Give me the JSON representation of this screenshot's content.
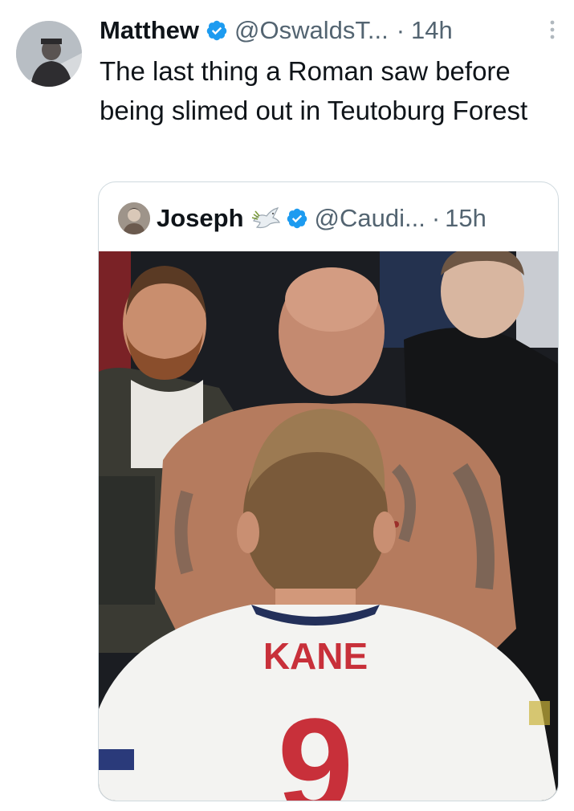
{
  "tweet": {
    "author_name": "Matthew",
    "handle": "@OswaldsT...",
    "separator": "·",
    "time": "14h",
    "text": "The last thing a Roman saw before being slimed out in Teutoburg Forest"
  },
  "quoted_tweet": {
    "author_name": "Joseph",
    "handle": "@Caudi...",
    "separator": "·",
    "time": "15h",
    "jersey_name": "KANE",
    "jersey_number": "9"
  },
  "icons": {
    "verified": "verified-badge-icon",
    "more": "more-vertical-icon",
    "dove": "dove-emoji-icon"
  },
  "colors": {
    "verified_blue": "#1d9bf0",
    "muted_text": "#536471",
    "primary_text": "#0f1419",
    "border": "#cfd9de",
    "jersey_red": "#c8303a"
  }
}
